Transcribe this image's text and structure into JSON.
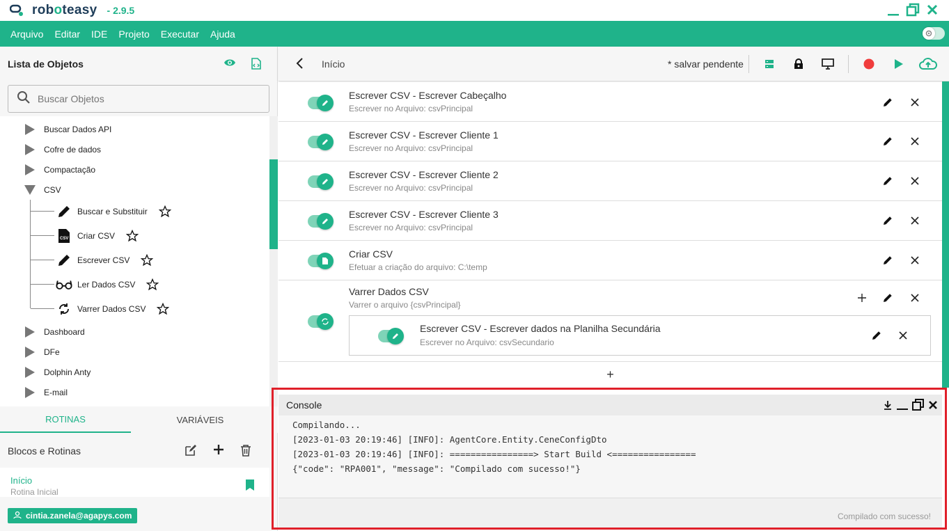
{
  "app": {
    "name_pre": "rob",
    "name_mid": "o",
    "name_post": "teasy",
    "version": "- 2.9.5"
  },
  "menu": [
    "Arquivo",
    "Editar",
    "IDE",
    "Projeto",
    "Executar",
    "Ajuda"
  ],
  "left": {
    "title": "Lista de Objetos",
    "search_placeholder": "Buscar Objetos",
    "tree": [
      {
        "label": "Buscar Dados API",
        "expanded": false
      },
      {
        "label": "Cofre de dados",
        "expanded": false
      },
      {
        "label": "Compactação",
        "expanded": false
      },
      {
        "label": "CSV",
        "expanded": true
      },
      {
        "label": "Dashboard",
        "expanded": false
      },
      {
        "label": "DFe",
        "expanded": false
      },
      {
        "label": "Dolphin Anty",
        "expanded": false
      },
      {
        "label": "E-mail",
        "expanded": false
      }
    ],
    "csv_children": [
      {
        "label": "Buscar e Substituir",
        "icon": "pencil-icon"
      },
      {
        "label": "Criar CSV",
        "icon": "csv-file-icon"
      },
      {
        "label": "Escrever CSV",
        "icon": "pencil-icon"
      },
      {
        "label": "Ler Dados CSV",
        "icon": "glasses-icon"
      },
      {
        "label": "Varrer Dados CSV",
        "icon": "loop-icon"
      }
    ],
    "tabs": {
      "active": "ROTINAS",
      "inactive": "VARIÁVEIS"
    },
    "blocks_title": "Blocos e Rotinas",
    "routine": {
      "title": "Início",
      "subtitle": "Rotina Inicial"
    },
    "user": "cintia.zanela@agapys.com"
  },
  "toolbar": {
    "breadcrumb": "Início",
    "pending": "* salvar pendente"
  },
  "steps": [
    {
      "title": "Escrever CSV - Escrever Cabeçalho",
      "subtitle": "Escrever no Arquivo: csvPrincipal",
      "icon": "pencil-icon"
    },
    {
      "title": "Escrever CSV - Escrever Cliente 1",
      "subtitle": "Escrever no Arquivo: csvPrincipal",
      "icon": "pencil-icon"
    },
    {
      "title": "Escrever CSV - Escrever Cliente 2",
      "subtitle": "Escrever no Arquivo: csvPrincipal",
      "icon": "pencil-icon"
    },
    {
      "title": "Escrever CSV - Escrever Cliente 3",
      "subtitle": "Escrever no Arquivo: csvPrincipal",
      "icon": "pencil-icon"
    },
    {
      "title": "Criar CSV",
      "subtitle": "Efetuar a criação do arquivo: C:\\temp",
      "icon": "file-icon"
    },
    {
      "title": "Varrer Dados CSV",
      "subtitle": "Varrer o arquivo {csvPrincipal}",
      "icon": "loop-icon",
      "child": {
        "title": "Escrever CSV - Escrever dados na Planilha Secundária",
        "subtitle": "Escrever no Arquivo: csvSecundario"
      }
    }
  ],
  "add_label": "+",
  "console": {
    "title": "Console",
    "lines": [
      "Compilando...",
      "[2023-01-03 20:19:46] [INFO]: AgentCore.Entity.CeneConfigDto",
      "[2023-01-03 20:19:46] [INFO]: ================> Start Build <================",
      "{\"code\": \"RPA001\", \"message\": \"Compilado com sucesso!\"}"
    ],
    "status": "Compilado com sucesso!"
  },
  "colors": {
    "accent": "#1fb38a",
    "record": "#f03c3c",
    "highlight": "#e0202a"
  }
}
